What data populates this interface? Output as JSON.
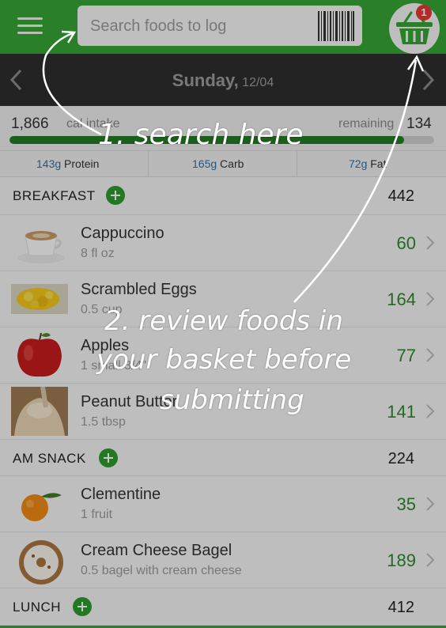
{
  "header": {
    "search_placeholder": "Search foods to log",
    "menu_icon": "hamburger-menu-icon",
    "barcode_icon": "barcode-icon",
    "basket_icon": "basket-icon",
    "basket_badge": "1",
    "accent_color": "#35a535"
  },
  "date_nav": {
    "day": "Sunday,",
    "date": "12/04"
  },
  "summary": {
    "intake_value": "1,866",
    "intake_label": "cal intake",
    "remaining_label": "remaining",
    "remaining_value": "134",
    "progress": 0.93
  },
  "macros": [
    {
      "value": "143g",
      "label": "Protein"
    },
    {
      "value": "165g",
      "label": "Carb"
    },
    {
      "value": "72g",
      "label": "Fat"
    }
  ],
  "sections": [
    {
      "title": "BREAKFAST",
      "calories": "442",
      "items": [
        {
          "name": "Cappuccino",
          "serving": "8 fl oz",
          "calories": "60"
        },
        {
          "name": "Scrambled Eggs",
          "serving": "0.5 cup",
          "calories": "164"
        },
        {
          "name": "Apples",
          "serving": "1 small 3/4\"",
          "calories": "77"
        },
        {
          "name": "Peanut Butter",
          "serving": "1.5 tbsp",
          "calories": "141"
        }
      ]
    },
    {
      "title": "AM SNACK",
      "calories": "224",
      "items": [
        {
          "name": "Clementine",
          "serving": "1 fruit",
          "calories": "35"
        },
        {
          "name": "Cream Cheese Bagel",
          "serving": "0.5 bagel with cream cheese",
          "calories": "189"
        }
      ]
    },
    {
      "title": "LUNCH",
      "calories": "412",
      "items": []
    }
  ],
  "annotations": {
    "search": "1. search here",
    "review_line1": "2. review foods in",
    "review_line2": "your basket before",
    "review_line3": "submitting"
  }
}
